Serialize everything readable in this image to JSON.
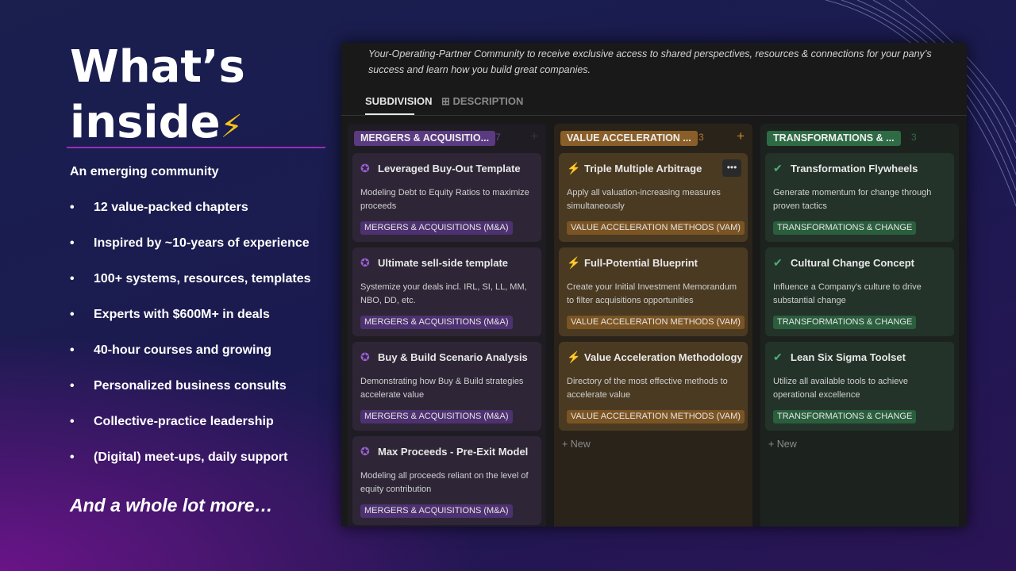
{
  "slide": {
    "title_line1": "What’s",
    "title_line2": "inside",
    "title_emoji": "⚡",
    "subtitle": "An emerging community",
    "bullets": [
      "12 value-packed chapters",
      "Inspired by ~10-years of experience",
      "100+ systems, resources, templates",
      "Experts with $600M+ in deals",
      "40-hour courses and growing",
      "Personalized business consults",
      "Collective-practice leadership",
      "(Digital) meet-ups, daily support"
    ],
    "closing": "And a whole lot more…"
  },
  "app": {
    "description": "Your-Operating-Partner Community to receive exclusive access to shared perspectives, resources & connections for your pany’s success and learn how you build great companies.",
    "tabs": [
      {
        "label": "SUBDIVISION"
      },
      {
        "label": "DESCRIPTION"
      }
    ],
    "new_label": "New",
    "columns": [
      {
        "title": "MERGERS & ACQUISITIO...",
        "count": "7",
        "tag": "MERGERS & ACQUISITIONS (M&A)",
        "icon": "✪",
        "cards": [
          {
            "title": "Leveraged Buy-Out Template",
            "desc": "Modeling Debt to Equity Ratios to maximize proceeds"
          },
          {
            "title": "Ultimate sell-side template",
            "desc": "Systemize your deals incl. IRL, SI, LL, MM, NBO, DD, etc."
          },
          {
            "title": "Buy & Build Scenario Analysis",
            "desc": "Demonstrating how Buy & Build strategies accelerate value"
          },
          {
            "title": "Max Proceeds - Pre-Exit Model",
            "desc": "Modeling all proceeds reliant on the level of equity contribution"
          }
        ]
      },
      {
        "title": "VALUE ACCELERATION ...",
        "count": "3",
        "tag": "VALUE ACCELERATION METHODS (VAM)",
        "icon": "⚡",
        "cards": [
          {
            "title": "Triple Multiple Arbitrage",
            "desc": "Apply all valuation-increasing measures simultaneously"
          },
          {
            "title": "Full-Potential Blueprint",
            "desc": "Create your Initial Investment Memorandum to filter acquisitions opportunities"
          },
          {
            "title": "Value Acceleration Methodology",
            "desc": "Directory of the most effective methods to accelerate value"
          }
        ]
      },
      {
        "title": "TRANSFORMATIONS & ...",
        "count": "3",
        "tag": "TRANSFORMATIONS & CHANGE",
        "icon": "✔",
        "cards": [
          {
            "title": "Transformation Flywheels",
            "desc": "Generate momentum for change through proven tactics"
          },
          {
            "title": "Cultural Change Concept",
            "desc": "Influence a Company's culture to drive substantial change"
          },
          {
            "title": "Lean Six Sigma Toolset",
            "desc": "Utilize all available tools to achieve operational excellence"
          }
        ]
      }
    ]
  }
}
